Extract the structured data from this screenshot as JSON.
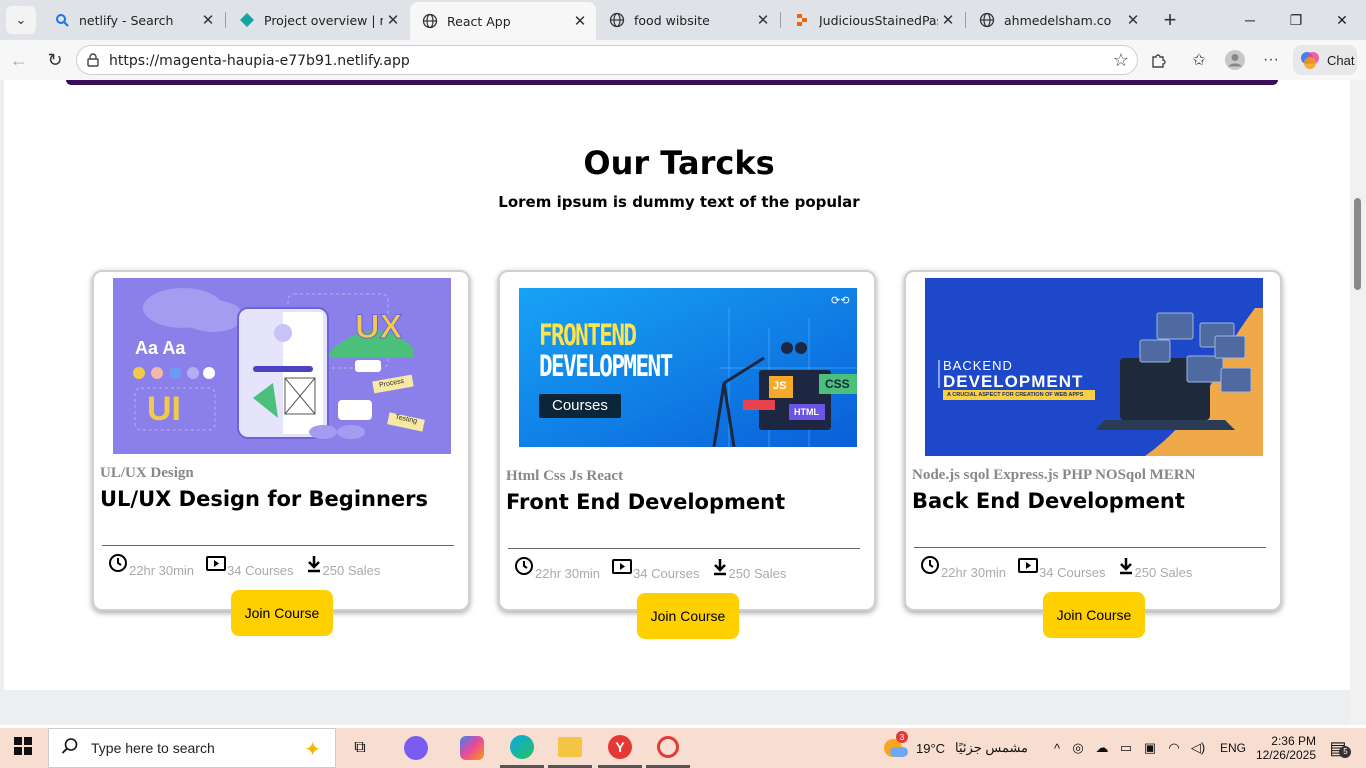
{
  "browser": {
    "tabs": [
      {
        "title": "netlify - Search",
        "icon": "search-icon"
      },
      {
        "title": "Project overview | magenta",
        "icon": "netlify-icon"
      },
      {
        "title": "React App",
        "icon": "globe-icon"
      },
      {
        "title": "food wibsite",
        "icon": "globe-icon"
      },
      {
        "title": "JudiciousStainedPassword",
        "icon": "replit-icon"
      },
      {
        "title": "ahmedelsham.co",
        "icon": "globe-icon"
      }
    ],
    "active_tab": 2,
    "url": "https://magenta-haupia-e77b91.netlify.app",
    "chat_label": "Chat"
  },
  "page": {
    "section_title": "Our Tarcks",
    "section_subtitle": "Lorem ipsum is dummy text of the popular",
    "cards": [
      {
        "tags": "UL/UX Design",
        "title": "UL/UX Design for Beginners",
        "duration": "22hr 30min",
        "courses": "34 Courses",
        "sales": "250 Sales",
        "button": "Join Course",
        "image": {
          "ux_label": "UX",
          "ui_label": "UI",
          "aa_label": "Aa Aa",
          "process_label": "Process",
          "testing_label": "Testing"
        }
      },
      {
        "tags": "Html Css Js React",
        "title": "Front End Development",
        "duration": "22hr 30min",
        "courses": "34 Courses",
        "sales": "250 Sales",
        "button": "Join Course",
        "image": {
          "line1": "FRONTEND",
          "line2": "DEVELOPMENT",
          "badge": "Courses",
          "js": "JS",
          "css": "CSS",
          "html": "HTML"
        }
      },
      {
        "tags": "Node.js sqol Express.js PHP NOSqol MERN",
        "title": "Back End Development",
        "duration": "22hr 30min",
        "courses": "34 Courses",
        "sales": "250 Sales",
        "button": "Join Course",
        "image": {
          "line1": "BACKEND",
          "line2": "DEVELOPMENT",
          "tagline": "A CRUCIAL ASPECT FOR CREATION OF WEB APPS"
        }
      }
    ]
  },
  "taskbar": {
    "search_placeholder": "Type here to search",
    "weather_temp": "19°C",
    "weather_desc": "مشمس جزئيًا",
    "weather_badge": "3",
    "language": "ENG",
    "time": "2:36 PM",
    "date": "12/26/2025",
    "notification_count": "5"
  },
  "colors": {
    "accent_yellow": "#ffd000",
    "nav_strip": "#3a0f5a",
    "taskbar": "#f8ded0"
  }
}
